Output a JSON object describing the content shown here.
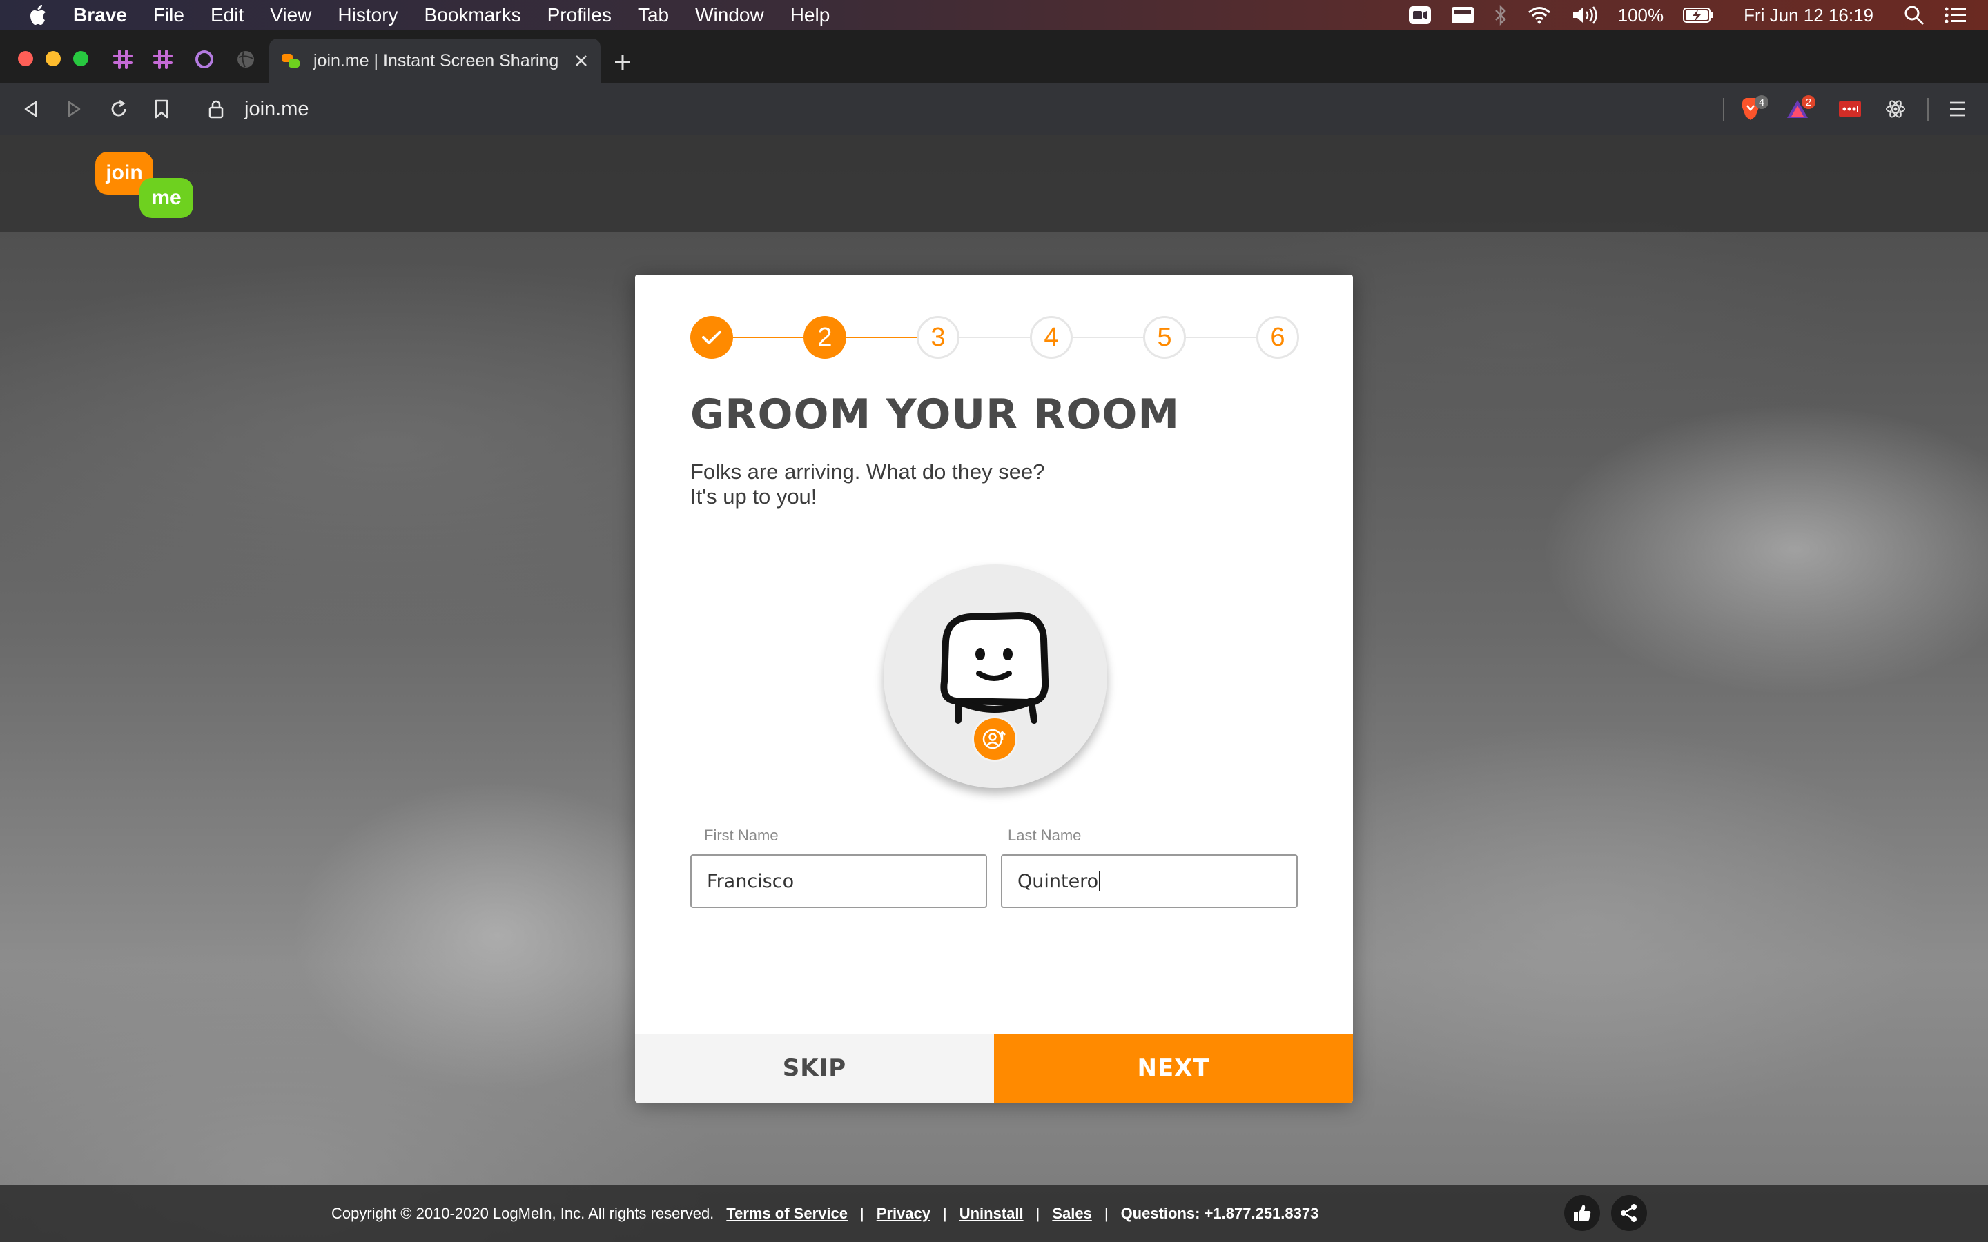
{
  "menubar": {
    "app_name": "Brave",
    "items": [
      "File",
      "Edit",
      "View",
      "History",
      "Bookmarks",
      "Profiles",
      "Tab",
      "Window",
      "Help"
    ],
    "battery": "100%",
    "datetime": "Fri Jun 12  16:19"
  },
  "browser": {
    "tab_title": "join.me | Instant Screen Sharing",
    "url": "join.me",
    "extensions": {
      "brave_shields_badge": "4",
      "rewards_badge": "2"
    }
  },
  "page": {
    "logo_top": "join",
    "logo_bottom": "me",
    "stepper": {
      "steps": [
        "✓",
        "2",
        "3",
        "4",
        "5",
        "6"
      ],
      "current": 2
    },
    "heading": "GROOM YOUR ROOM",
    "description_line1": "Folks are arriving. What do they see?",
    "description_line2": "It's up to you!",
    "first_name_label": "First Name",
    "first_name_value": "Francisco",
    "last_name_label": "Last Name",
    "last_name_value": "Quintero",
    "skip_label": "SKIP",
    "next_label": "NEXT"
  },
  "footer": {
    "copyright": "Copyright © 2010-2020 LogMeIn, Inc. All rights reserved.",
    "links": [
      "Terms of Service",
      "Privacy",
      "Uninstall",
      "Sales"
    ],
    "questions": "Questions: +1.877.251.8373"
  },
  "colors": {
    "accent": "#ff8a00",
    "logo_green": "#6ed11f"
  }
}
